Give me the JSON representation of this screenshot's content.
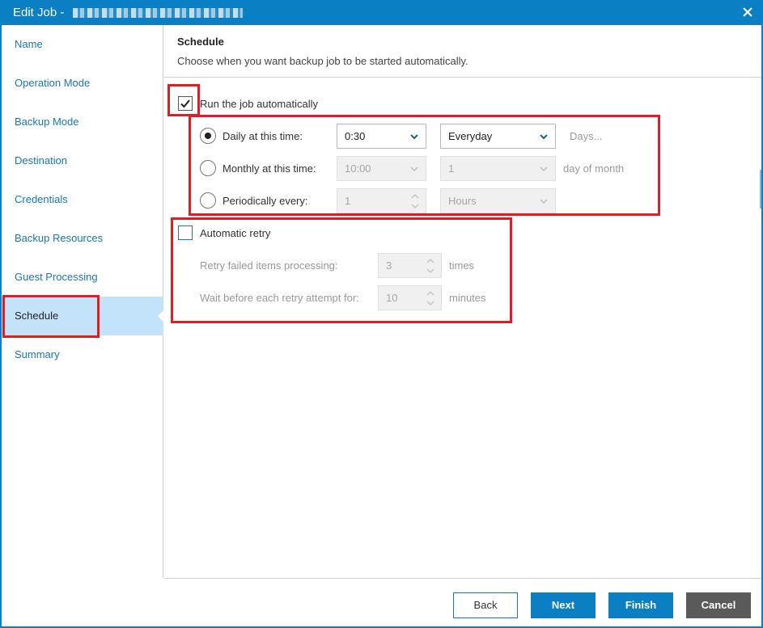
{
  "window": {
    "title": "Edit Job - "
  },
  "sidebar": {
    "items": [
      {
        "label": "Name"
      },
      {
        "label": "Operation Mode"
      },
      {
        "label": "Backup Mode"
      },
      {
        "label": "Destination"
      },
      {
        "label": "Credentials"
      },
      {
        "label": "Backup Resources"
      },
      {
        "label": "Guest Processing"
      },
      {
        "label": "Schedule"
      },
      {
        "label": "Summary"
      }
    ],
    "active_index": 7
  },
  "header": {
    "title": "Schedule",
    "subtitle": "Choose when you want backup job to be started automatically."
  },
  "schedule": {
    "run_automatically": {
      "label": "Run the job automatically",
      "checked": true
    },
    "daily": {
      "label": "Daily at this time:",
      "selected": true,
      "time": "0:30",
      "days": "Everyday",
      "days_link": "Days..."
    },
    "monthly": {
      "label": "Monthly at this time:",
      "selected": false,
      "time": "10:00",
      "day": "1",
      "suffix": "day of month"
    },
    "periodic": {
      "label": "Periodically every:",
      "selected": false,
      "value": "1",
      "unit": "Hours"
    }
  },
  "retry": {
    "label": "Automatic retry",
    "checked": false,
    "failed_label": "Retry failed items processing:",
    "failed_value": "3",
    "failed_unit": "times",
    "wait_label": "Wait before each retry attempt for:",
    "wait_value": "10",
    "wait_unit": "minutes"
  },
  "footer": {
    "back": "Back",
    "next": "Next",
    "finish": "Finish",
    "cancel": "Cancel"
  },
  "colors": {
    "accent": "#0b7fc3",
    "highlight": "#e31c23",
    "active_nav": "#c3e3fa"
  },
  "icons": [
    "close-icon",
    "checkmark-icon",
    "chevron-down-icon",
    "spinner-arrows-icon"
  ]
}
